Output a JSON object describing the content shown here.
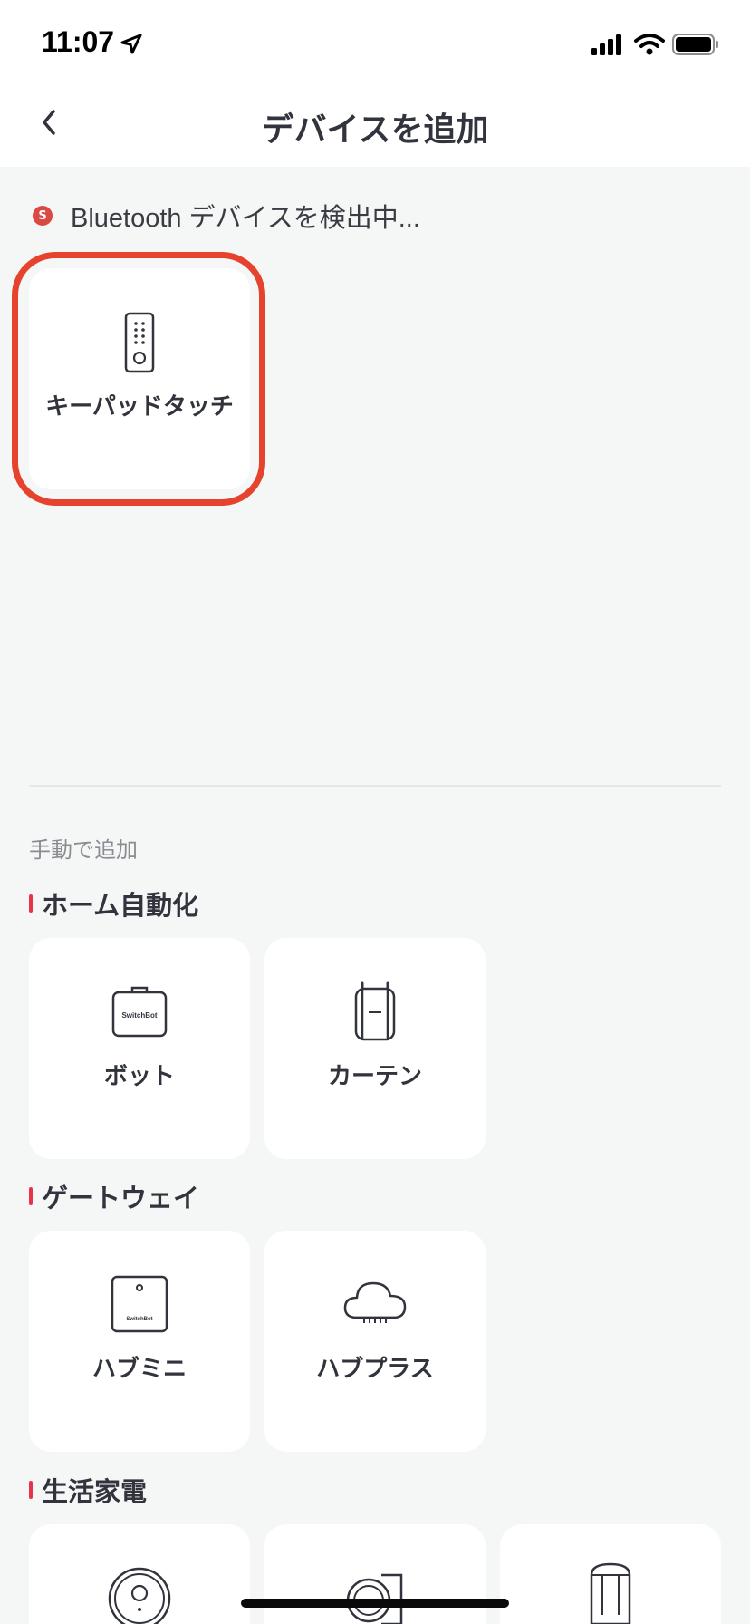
{
  "status_bar": {
    "time": "11:07",
    "icons": [
      "location-arrow-icon",
      "cellular-signal-icon",
      "wifi-icon",
      "battery-icon"
    ]
  },
  "nav": {
    "title": "デバイスを追加",
    "back_icon": "chevron-left-icon"
  },
  "scan": {
    "icon": "switchbot-logo-icon",
    "icon_letter": "S",
    "label": "Bluetooth デバイスを検出中..."
  },
  "found_devices": [
    {
      "label": "キーパッドタッチ",
      "icon": "keypad-touch-icon"
    }
  ],
  "manual": {
    "label": "手動で追加",
    "sections": [
      {
        "title": "ホーム自動化",
        "devices": [
          {
            "label": "ボット",
            "icon": "bot-icon",
            "icon_text": "SwitchBot"
          },
          {
            "label": "カーテン",
            "icon": "curtain-icon"
          }
        ]
      },
      {
        "title": "ゲートウェイ",
        "devices": [
          {
            "label": "ハブミニ",
            "icon": "hub-mini-icon",
            "icon_text": "SwitchBot"
          },
          {
            "label": "ハブプラス",
            "icon": "hub-plus-cloud-icon"
          }
        ]
      },
      {
        "title": "生活家電",
        "devices": [
          {
            "label": "",
            "icon": "robot-vacuum-icon"
          },
          {
            "label": "",
            "icon": "vacuum-dock-icon"
          },
          {
            "label": "",
            "icon": "humidifier-icon"
          }
        ]
      }
    ]
  },
  "colors": {
    "background": "#f5f6f6",
    "card": "#ffffff",
    "highlight_outline": "#e5432d",
    "section_accent": "#e8344a",
    "brand": "#d84a43",
    "text": "#32343d"
  }
}
